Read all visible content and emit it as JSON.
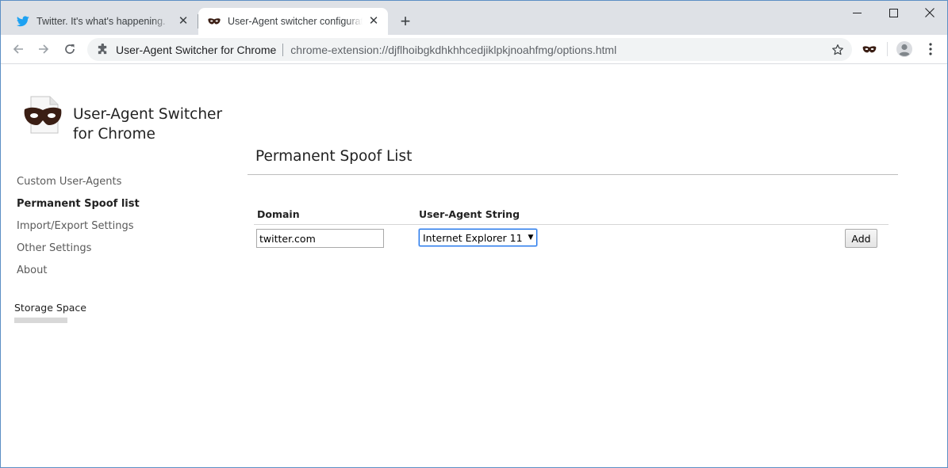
{
  "browser": {
    "tabs": [
      {
        "title": "Twitter. It's what's happening.",
        "close": "✕"
      },
      {
        "title": "User-Agent switcher configuration",
        "close": "✕"
      }
    ],
    "new_tab": "+",
    "address_bar": {
      "origin": "User-Agent Switcher for Chrome",
      "url": "chrome-extension://djflhoibgkdhkhhcedjiklpkjnoahfmg/options.html"
    },
    "colors": {
      "tabstrip": "#dee1e6",
      "twitter_blue": "#1da1f2",
      "window_border": "#5c8fc4"
    }
  },
  "sidebar": {
    "app_name": "User-Agent Switcher for Chrome",
    "nav": [
      {
        "label": "Custom User-Agents",
        "active": false
      },
      {
        "label": "Permanent Spoof list",
        "active": true
      },
      {
        "label": "Import/Export Settings",
        "active": false
      },
      {
        "label": "Other Settings",
        "active": false
      },
      {
        "label": "About",
        "active": false
      }
    ],
    "storage_label": "Storage Space"
  },
  "main": {
    "heading": "Permanent Spoof List",
    "columns": {
      "domain": "Domain",
      "ua_string": "User-Agent String"
    },
    "row": {
      "domain_value": "twitter.com",
      "ua_selected": "Internet Explorer 11",
      "add_label": "Add"
    }
  }
}
